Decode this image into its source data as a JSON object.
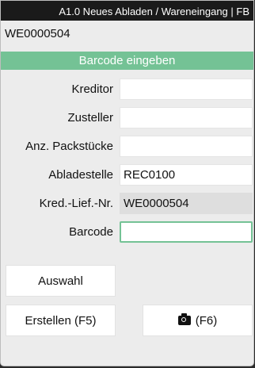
{
  "window": {
    "title": "A1.0 Neues Abladen / Wareneingang | FB"
  },
  "header": {
    "doc_number": "WE0000504"
  },
  "section": {
    "title": "Barcode eingeben"
  },
  "form": {
    "kreditor": {
      "label": "Kreditor",
      "value": ""
    },
    "zusteller": {
      "label": "Zusteller",
      "value": ""
    },
    "packstuecke": {
      "label": "Anz. Packstücke",
      "value": ""
    },
    "abladestelle": {
      "label": "Abladestelle",
      "value": "REC0100"
    },
    "kred_lief_nr": {
      "label": "Kred.-Lief.-Nr.",
      "value": "WE0000504"
    },
    "barcode": {
      "label": "Barcode",
      "value": ""
    }
  },
  "buttons": {
    "auswahl": "Auswahl",
    "erstellen": "Erstellen (F5)",
    "camera": "(F6)"
  },
  "icons": {
    "camera": "camera-icon"
  },
  "colors": {
    "accent": "#74c295",
    "titlebar": "#1a1a1a"
  }
}
